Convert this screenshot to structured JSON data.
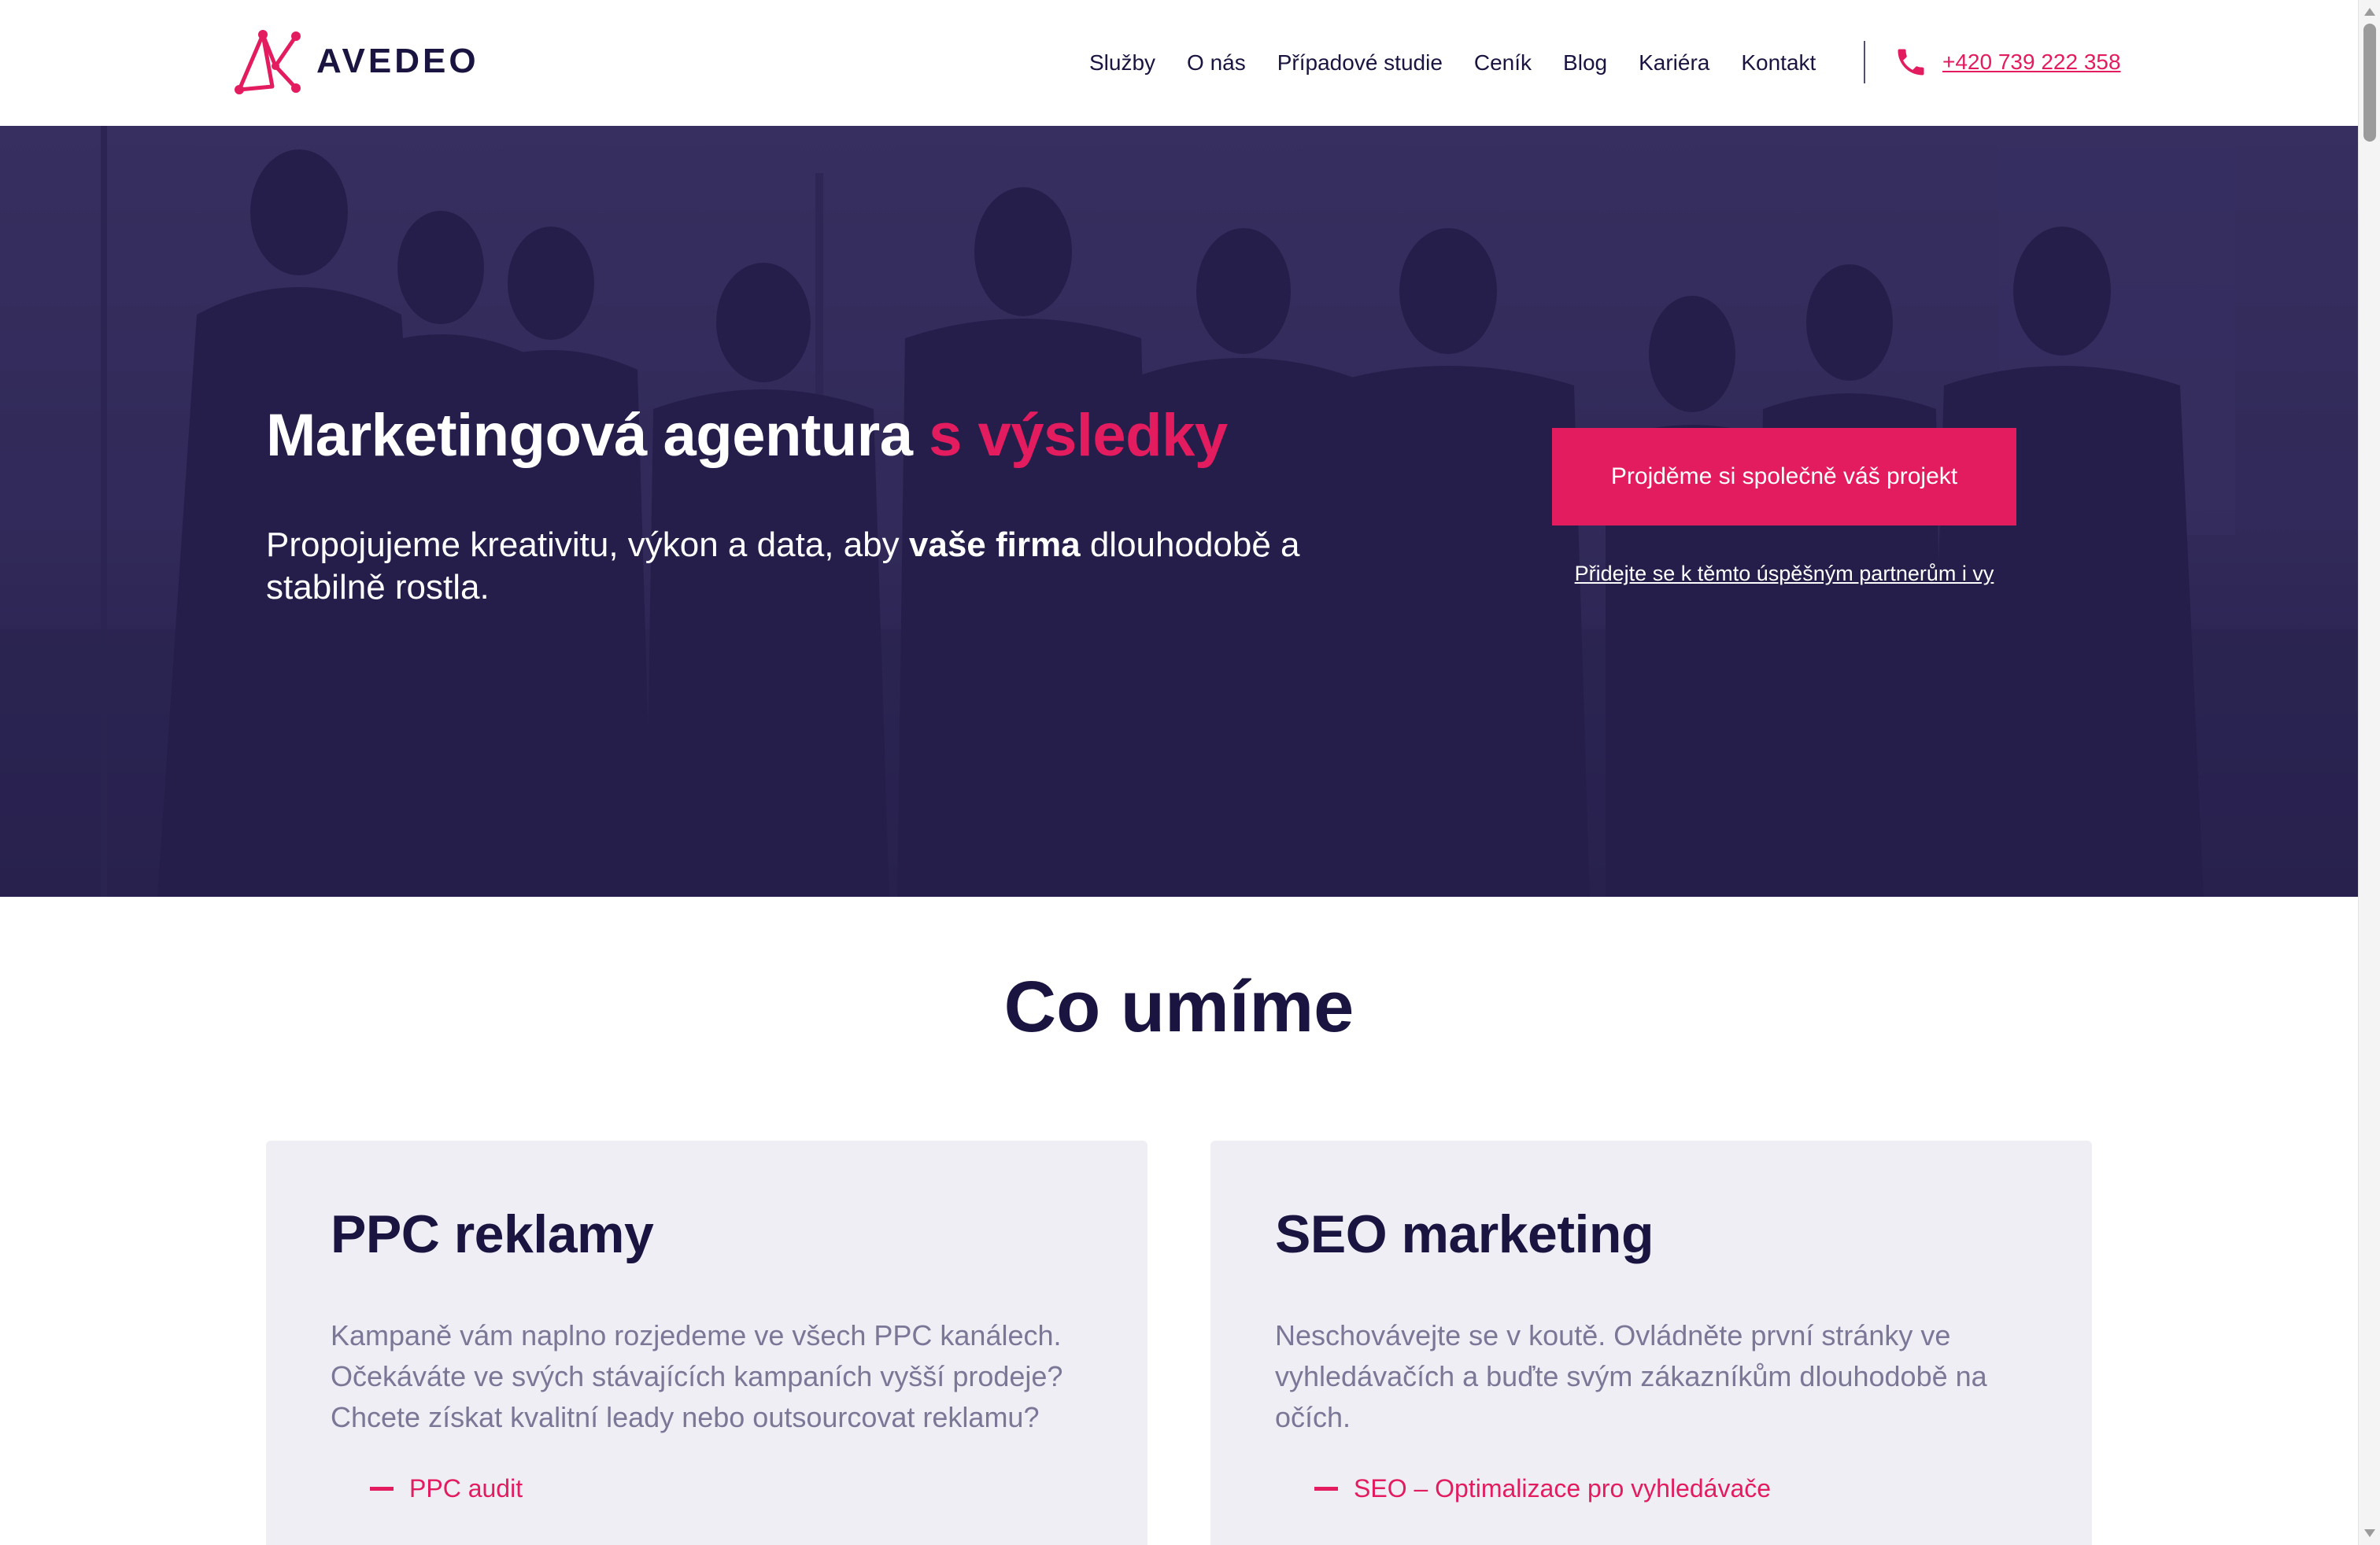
{
  "header": {
    "logo_text": "AVEDEO",
    "logo_icon": "avedeo-network-mark",
    "nav": [
      "Služby",
      "O nás",
      "Případové studie",
      "Ceník",
      "Blog",
      "Kariéra",
      "Kontakt"
    ],
    "phone_icon": "phone-icon",
    "phone": "+420 739 222 358"
  },
  "hero": {
    "title_main": "Marketingová agentura ",
    "title_accent": "s výsledky",
    "subtitle_before": "Propojujeme kreativitu, výkon a data, aby ",
    "subtitle_bold": "vaše firma",
    "subtitle_after": " dlouhodobě a stabilně rostla.",
    "cta_label": "Projděme si společně váš projekt",
    "partners_link": "Přidejte se k těmto úspěšným partnerům i vy"
  },
  "services": {
    "title": "Co umíme",
    "cards": [
      {
        "title": "PPC reklamy",
        "text": "Kampaně vám naplno rozjedeme ve všech PPC kanálech. Očekáváte ve svých stávajících kampaních vyšší prodeje? Chcete získat kvalitní leady nebo outsourcovat reklamu?",
        "links": [
          "PPC audit"
        ]
      },
      {
        "title": "SEO marketing",
        "text": "Neschovávejte se v koutě. Ovládněte první stránky ve vyhledávačích a buďte svým zákazníkům dlouhodobě na očích.",
        "links": [
          "SEO – Optimalizace pro vyhledávače"
        ]
      }
    ]
  },
  "colors": {
    "brand_accent": "#e31c5f",
    "brand_dark": "#1a1440",
    "hero_overlay": "#2b2452",
    "card_bg": "#efeef5",
    "body_text_muted": "#7b7796"
  }
}
